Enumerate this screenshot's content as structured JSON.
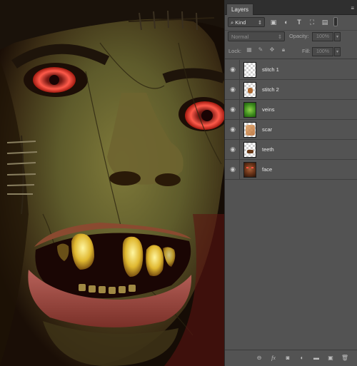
{
  "panel": {
    "tab_label": "Layers",
    "filter": {
      "kind_label": "Kind",
      "icons": [
        "search-icon",
        "pixel-filter-icon",
        "adjustment-filter-icon",
        "type-filter-icon",
        "shape-filter-icon",
        "smart-object-filter-icon"
      ]
    },
    "blend_mode": "Normal",
    "opacity_label": "Opacity:",
    "opacity_value": "100%",
    "lock_label": "Lock:",
    "fill_label": "Fill:",
    "fill_value": "100%",
    "layers": [
      {
        "name": "stitch 1",
        "visible": true,
        "thumb": "checker"
      },
      {
        "name": "stitch 2",
        "visible": true,
        "thumb": "checker-orange"
      },
      {
        "name": "veins",
        "visible": true,
        "thumb": "green"
      },
      {
        "name": "scar",
        "visible": true,
        "thumb": "checker-orange"
      },
      {
        "name": "teeth",
        "visible": true,
        "thumb": "checker-dark"
      },
      {
        "name": "face",
        "visible": true,
        "thumb": "face"
      }
    ],
    "footer_icons": [
      "link-icon",
      "fx-icon",
      "mask-icon",
      "adjustment-layer-icon",
      "group-folder-icon",
      "new-layer-icon",
      "trash-icon"
    ]
  },
  "colors": {
    "panel_bg": "#535353",
    "selected_row": "#535353",
    "eye": "#c8c8c8"
  }
}
